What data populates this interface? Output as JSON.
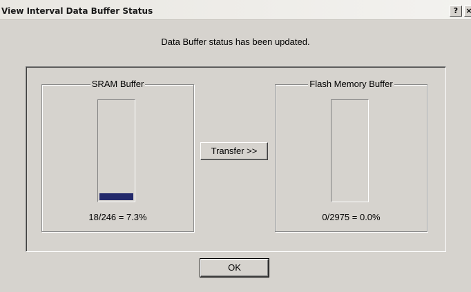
{
  "window": {
    "title": "View Interval Data Buffer Status",
    "help_button": "?",
    "close_button": "×"
  },
  "message": "Data Buffer status has been updated.",
  "sram": {
    "label": "SRAM Buffer",
    "used": 18,
    "capacity": 246,
    "fill_fraction": 0.073,
    "ratio_text": "18/246 = 7.3%"
  },
  "flash": {
    "label": "Flash Memory Buffer",
    "used": 0,
    "capacity": 2975,
    "fill_fraction": 0.0,
    "ratio_text": "0/2975 = 0.0%"
  },
  "buttons": {
    "transfer_label": "Transfer >>",
    "ok_label": "OK"
  },
  "colors": {
    "fill": "#23296b",
    "dialog_bg": "#d6d3ce"
  }
}
